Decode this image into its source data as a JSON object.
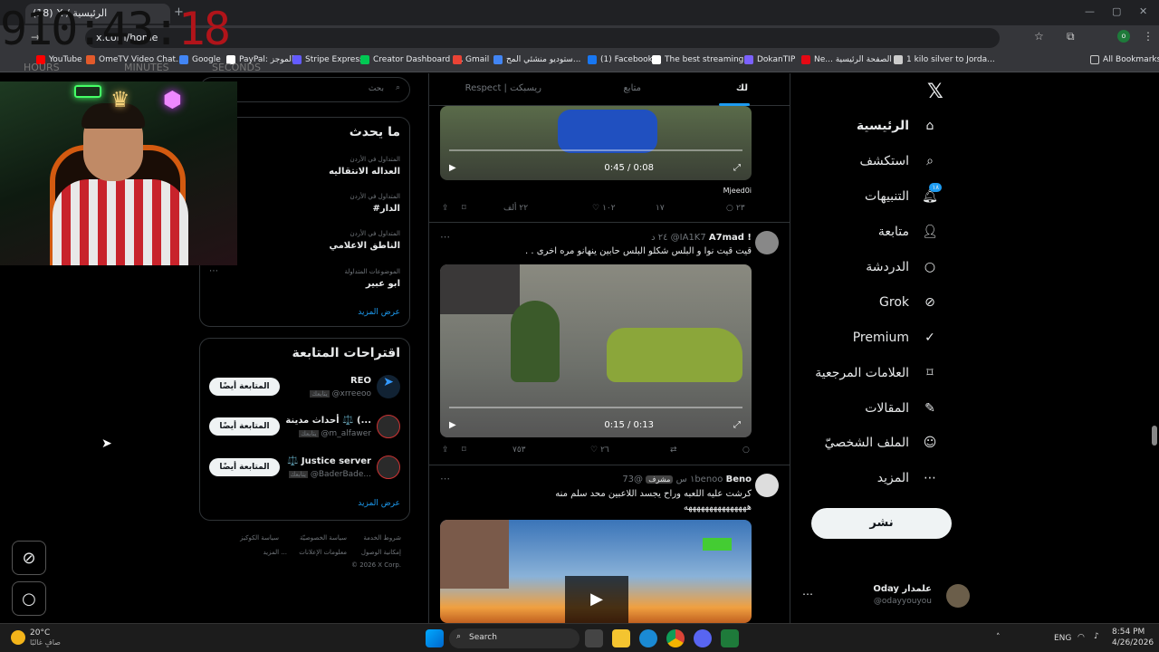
{
  "browser": {
    "tab_title": "(18) X / الرئيسية",
    "url": "x.com/home",
    "bookmarks": [
      "YouTube",
      "OmeTV Video Chat...",
      "Google",
      "PayPal: الموجز",
      "Stripe Express",
      "Creator Dashboard |...",
      "Gmail",
      "ستوديو منشئي المح...",
      "(1) Facebook",
      "The best streaming...",
      "DokanTIP",
      "Ne... الصفحة الرئيسية",
      "1 kilo silver to Jorda..."
    ],
    "all_bookmarks": "All Bookmarks",
    "bookmark_colors": [
      "#ff0000",
      "#e25a2b",
      "#4285f4",
      "#ffffff",
      "#635bff",
      "#00c853",
      "#ea4335",
      "#4285f4",
      "#1877f2",
      "#ffffff",
      "#7b61ff",
      "#e50914",
      "#cccccc"
    ]
  },
  "overlay": {
    "clock_main": "910:43:",
    "clock_sec": "18",
    "lbl_hours": "HOURS",
    "lbl_minutes": "MINUTES",
    "lbl_seconds": "SECONDS"
  },
  "nav": {
    "items": [
      "الرئيسية",
      "استكشف",
      "التنبيهات",
      "متابعة",
      "الدردشة",
      "Grok",
      "Premium",
      "العلامات المرجعية",
      "المقالات",
      "الملف الشخصيّ",
      "المزيد"
    ],
    "notif_badge": "١٨",
    "post_button": "نشر",
    "account": {
      "name": "Oday علمدار",
      "handle": "@odayyouyou"
    }
  },
  "feed": {
    "tabs": {
      "for_you": "لك",
      "following": "متابع",
      "respect": "Respect | ريسبكت"
    },
    "t1": {
      "time": "0:45 / 0:08",
      "from": "Mjeed0i",
      "replies": "٢٣",
      "reposts": "١٧",
      "likes": "١٠٢",
      "views": "٢٢ ألف"
    },
    "t2": {
      "name": "A7mad !",
      "handle": "@IA1K7",
      "time": "٢٤ د",
      "text": "قيت قيت نوا و البلس شكلو البلس حابين ينهانو مره اخرى . .",
      "video_time": "0:15 / 0:13",
      "likes": "٢٦",
      "views": "٧٥٣"
    },
    "t3": {
      "name": "Beno",
      "handle": "@73benoo",
      "badge": "مشرف",
      "time": "١ س",
      "text1": "كرشت عليه اللعبه وراح يجسد اللاعبين محد سلم منه",
      "text2": "هههههههههههههههه"
    }
  },
  "right": {
    "search": "بحث",
    "trends_title": "ما يحدث",
    "trends": [
      {
        "meta": "المتداول في الأردن",
        "name": "العداله الانتقاليه"
      },
      {
        "meta": "المتداول في الأردن",
        "name": "#الدار"
      },
      {
        "meta": "المتداول في الأردن",
        "name": "الناطق الاعلامي"
      },
      {
        "meta": "الموضوعات المتداولة",
        "name": "ابو عبير"
      }
    ],
    "show_more": "عرض المزيد",
    "suggest_title": "اقتراحات المتابعة",
    "suggest": [
      {
        "name": "REO",
        "handle": "@xrreeoo",
        "btn": "المتابعة أيضًا"
      },
      {
        "name": "أحداث مدينة ⚖️ (...",
        "handle": "@m_alfawer",
        "btn": "المتابعة أيضًا"
      },
      {
        "name": "⚖️ Justice server",
        "handle": "@BaderBade...",
        "btn": "المتابعة أيضًا"
      }
    ],
    "show_more2": "عرض المزيد",
    "footer": [
      "شروط الخدمة",
      "سياسة الخصوصيّة",
      "سياسة الكوكيز",
      "إمكانية الوصول",
      "معلومات الإعلانات",
      "المزيد ...",
      "© 2026 X Corp."
    ],
    "follows_you": "يتابعك"
  },
  "taskbar": {
    "weather_temp": "20°C",
    "weather_desc": "صافٍ غالبًا",
    "search": "Search",
    "lang": "ENG",
    "time": "8:54 PM",
    "date": "4/26/2026"
  }
}
